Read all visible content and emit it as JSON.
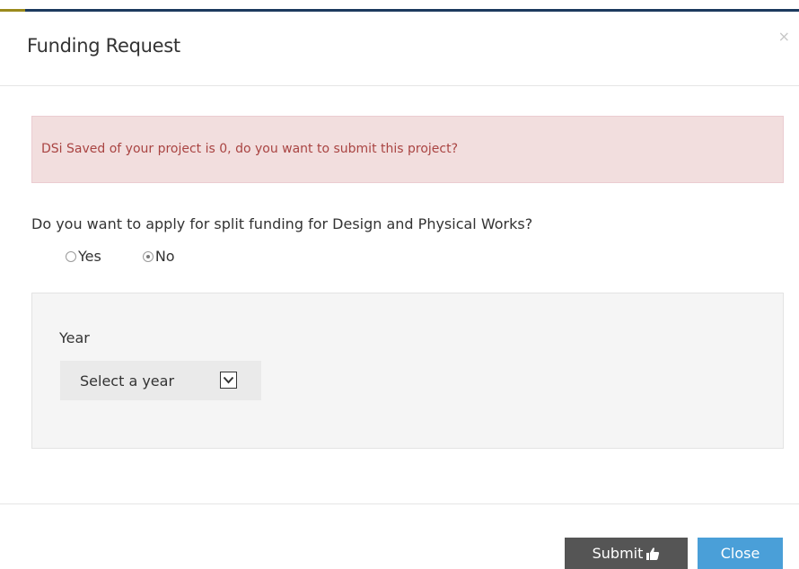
{
  "modal": {
    "title": "Funding Request",
    "close_glyph": "×"
  },
  "alert": {
    "message": "DSi Saved of your project is 0, do you want to submit this project?"
  },
  "split_funding": {
    "question": "Do you want to apply for split funding for Design and Physical Works?",
    "options": [
      {
        "label": "Yes",
        "checked": false
      },
      {
        "label": "No",
        "checked": true
      }
    ]
  },
  "year": {
    "label": "Year",
    "selected": "Select a year"
  },
  "footer": {
    "submit_label": "Submit",
    "close_label": "Close"
  },
  "colors": {
    "submit_bg": "#555555",
    "close_bg": "#4a9fd8",
    "alert_bg": "#f2dede",
    "alert_text": "#a94442"
  },
  "icons": {
    "submit": "thumbs-up-icon",
    "select": "chevron-down-icon",
    "dismiss": "close-icon"
  }
}
